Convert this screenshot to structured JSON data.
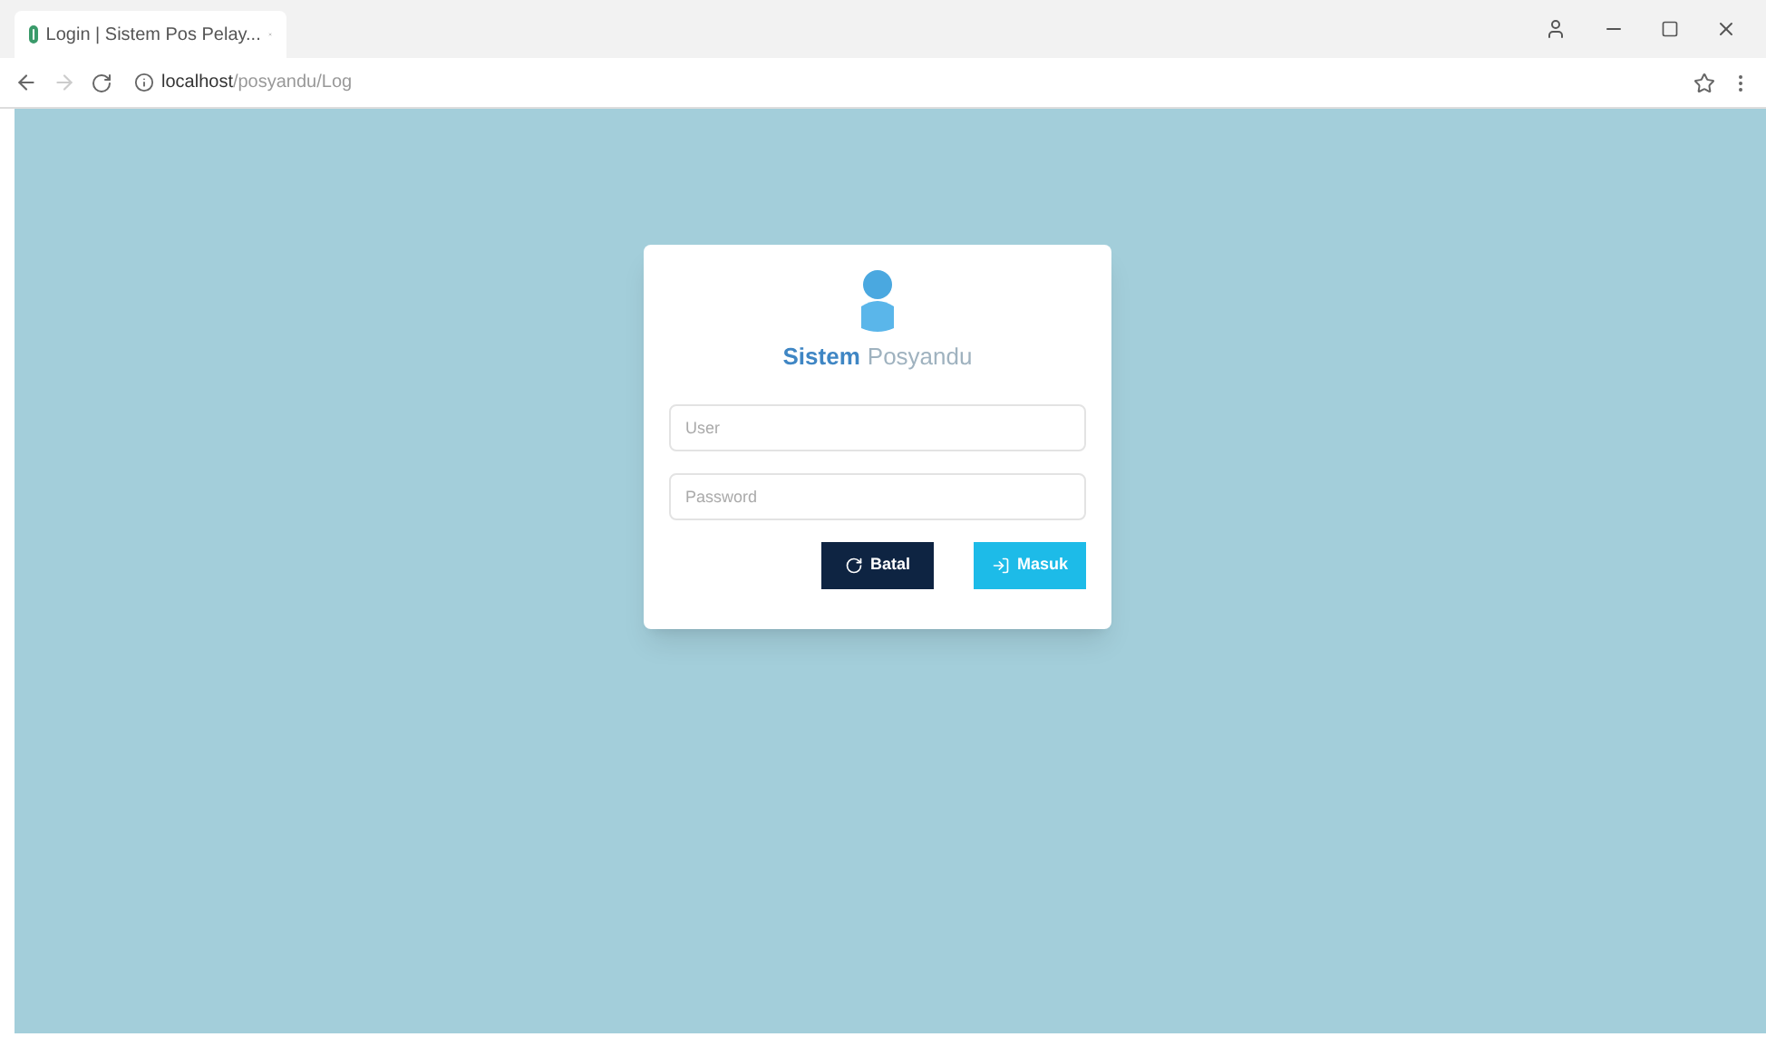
{
  "browser": {
    "tab_title": "Login | Sistem Pos Pelay...",
    "url_host": "localhost",
    "url_path": "/posyandu/Log"
  },
  "login": {
    "brand_bold": "Sistem",
    "brand_light": "Posyandu",
    "fields": [
      {
        "placeholder": "User"
      },
      {
        "placeholder": "Password"
      }
    ],
    "buttons": [
      {
        "label": "Batal",
        "kind": "cancel"
      },
      {
        "label": "Masuk",
        "kind": "submit"
      }
    ]
  }
}
